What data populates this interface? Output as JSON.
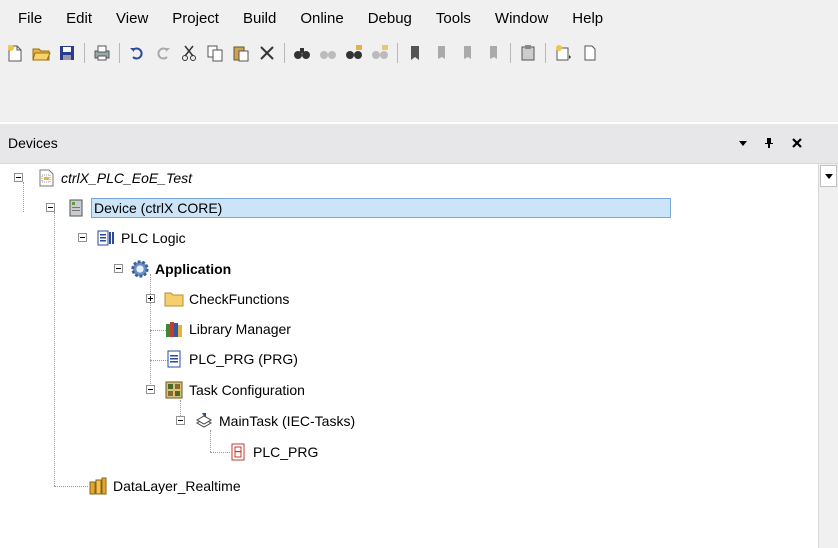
{
  "menu": [
    "File",
    "Edit",
    "View",
    "Project",
    "Build",
    "Online",
    "Debug",
    "Tools",
    "Window",
    "Help"
  ],
  "toolbar": {
    "icons": [
      "new-project-icon",
      "open-project-icon",
      "save-icon",
      "print-icon",
      "undo-icon",
      "redo-icon",
      "cut-icon",
      "copy-icon",
      "paste-icon",
      "delete-icon",
      "find-icon",
      "find-next-icon",
      "find-replace-icon",
      "replace-icon",
      "bookmark-icon",
      "bookmark-next-icon",
      "bookmark-prev-icon",
      "bookmark-clear-icon",
      "clipboard-icon",
      "add-object-icon",
      "overflow-icon"
    ]
  },
  "panel": {
    "title": "Devices",
    "tree": [
      {
        "label": "ctrlX_PLC_EoE_Test",
        "icon": "project-icon",
        "style": "italic"
      },
      {
        "label": "Device (ctrlX CORE)",
        "icon": "device-icon",
        "selected": true
      },
      {
        "label": "PLC Logic",
        "icon": "plc-logic-icon"
      },
      {
        "label": "Application",
        "icon": "application-gear-icon",
        "style": "bold"
      },
      {
        "label": "CheckFunctions",
        "icon": "folder-icon"
      },
      {
        "label": "Library Manager",
        "icon": "library-icon"
      },
      {
        "label": "PLC_PRG (PRG)",
        "icon": "program-icon"
      },
      {
        "label": "Task Configuration",
        "icon": "task-config-icon"
      },
      {
        "label": "MainTask (IEC-Tasks)",
        "icon": "task-icon"
      },
      {
        "label": "PLC_PRG",
        "icon": "program-call-icon"
      },
      {
        "label": "DataLayer_Realtime",
        "icon": "datalayer-icon"
      }
    ]
  },
  "colors": {
    "selection_bg": "#cce4f7",
    "selection_border": "#7aa7d9",
    "chrome_bg": "#f0f0f0",
    "panel_header_bg": "#e7e7e9"
  }
}
